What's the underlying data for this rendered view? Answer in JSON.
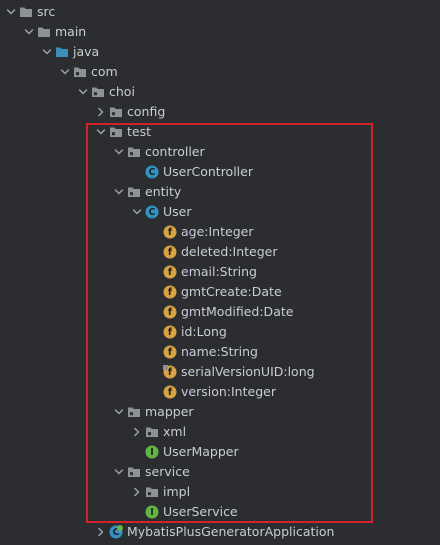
{
  "tree": [
    {
      "label": "src",
      "kind": "folder",
      "arrow": "down",
      "depth": 0
    },
    {
      "label": "main",
      "kind": "folder",
      "arrow": "down",
      "depth": 1
    },
    {
      "label": "java",
      "kind": "source-folder",
      "arrow": "down",
      "depth": 2
    },
    {
      "label": "com",
      "kind": "package",
      "arrow": "down",
      "depth": 3
    },
    {
      "label": "choi",
      "kind": "package",
      "arrow": "down",
      "depth": 4
    },
    {
      "label": "config",
      "kind": "package",
      "arrow": "right",
      "depth": 5
    },
    {
      "label": "test",
      "kind": "package",
      "arrow": "down",
      "depth": 5
    },
    {
      "label": "controller",
      "kind": "package",
      "arrow": "down",
      "depth": 6
    },
    {
      "label": "UserController",
      "kind": "class",
      "arrow": "none",
      "depth": 7
    },
    {
      "label": "entity",
      "kind": "package",
      "arrow": "down",
      "depth": 6
    },
    {
      "label": "User",
      "kind": "class",
      "arrow": "down",
      "depth": 7
    },
    {
      "label": "age:Integer",
      "kind": "field",
      "arrow": "none",
      "depth": 8
    },
    {
      "label": "deleted:Integer",
      "kind": "field",
      "arrow": "none",
      "depth": 8
    },
    {
      "label": "email:String",
      "kind": "field",
      "arrow": "none",
      "depth": 8
    },
    {
      "label": "gmtCreate:Date",
      "kind": "field",
      "arrow": "none",
      "depth": 8
    },
    {
      "label": "gmtModified:Date",
      "kind": "field",
      "arrow": "none",
      "depth": 8
    },
    {
      "label": "id:Long",
      "kind": "field",
      "arrow": "none",
      "depth": 8
    },
    {
      "label": "name:String",
      "kind": "field",
      "arrow": "none",
      "depth": 8
    },
    {
      "label": "serialVersionUID:long",
      "kind": "static-field",
      "arrow": "none",
      "depth": 8
    },
    {
      "label": "version:Integer",
      "kind": "field",
      "arrow": "none",
      "depth": 8
    },
    {
      "label": "mapper",
      "kind": "package",
      "arrow": "down",
      "depth": 6
    },
    {
      "label": "xml",
      "kind": "package",
      "arrow": "right",
      "depth": 7
    },
    {
      "label": "UserMapper",
      "kind": "interface",
      "arrow": "none",
      "depth": 7
    },
    {
      "label": "service",
      "kind": "package",
      "arrow": "down",
      "depth": 6
    },
    {
      "label": "impl",
      "kind": "package",
      "arrow": "right",
      "depth": 7
    },
    {
      "label": "UserService",
      "kind": "interface",
      "arrow": "none",
      "depth": 7
    },
    {
      "label": "MybatisPlusGeneratorApplication",
      "kind": "spring-class",
      "arrow": "right",
      "depth": 5
    }
  ],
  "icons": {
    "class": {
      "letter": "C",
      "color": "#3592c4"
    },
    "interface": {
      "letter": "I",
      "color": "#62b543"
    },
    "field": {
      "letter": "f",
      "color": "#d9a343"
    },
    "static-field": {
      "letter": "f",
      "color": "#d9a343"
    },
    "folder": {
      "color": "#8e9196"
    },
    "package": {
      "color": "#8e9196"
    },
    "source-folder": {
      "color": "#3d8ebd"
    },
    "spring-class": {
      "letter": "C",
      "color": "#3592c4",
      "accent": "#6db33f"
    }
  },
  "colors": {
    "background": "#2b2d30",
    "text": "#c9ccd2",
    "highlight_border": "#d2222b",
    "arrow": "#9da0a6"
  }
}
